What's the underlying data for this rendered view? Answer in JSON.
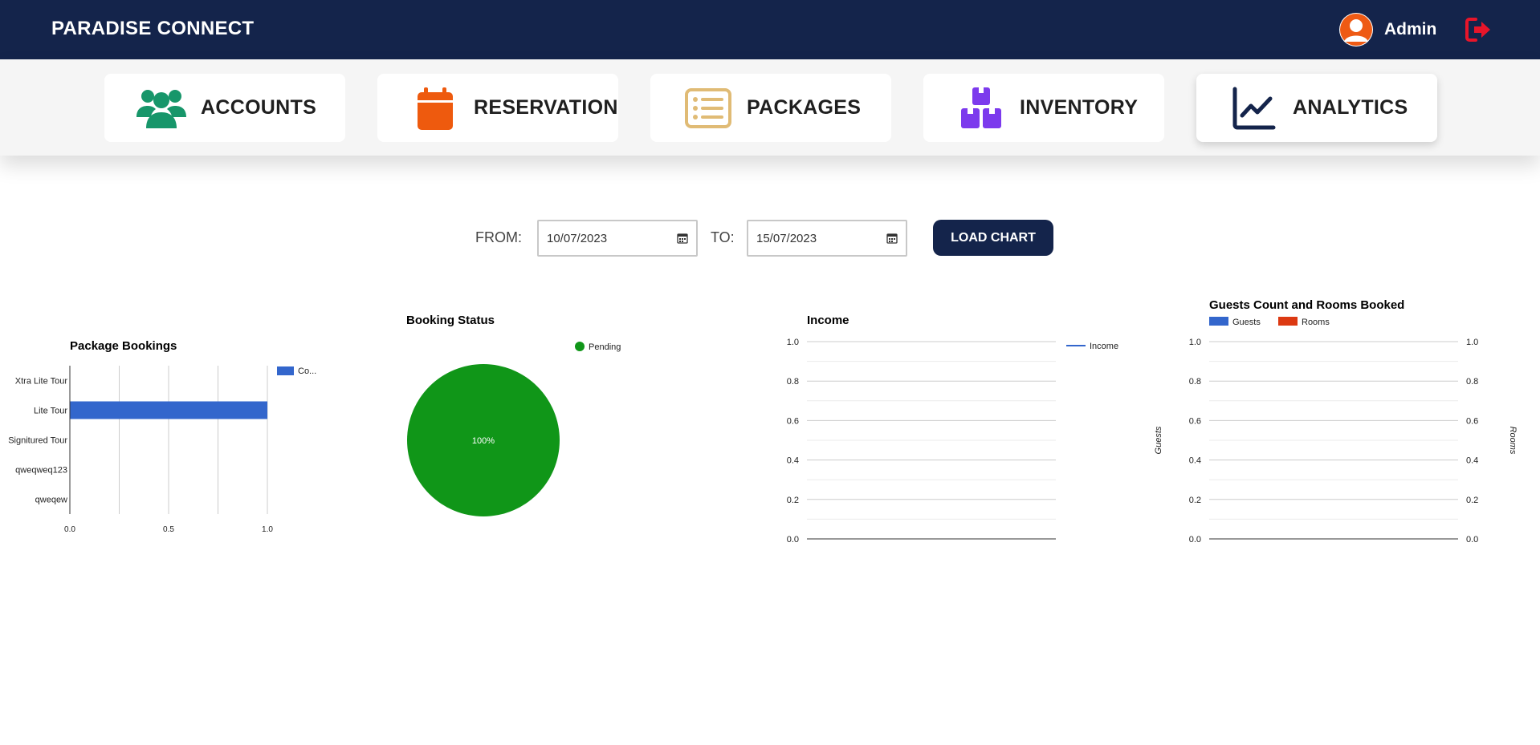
{
  "header": {
    "brand": "PARADISE CONNECT",
    "user_name": "Admin",
    "colors": {
      "bar": "#14244b",
      "avatar": "#ee5a14",
      "logout": "#e8152a"
    }
  },
  "nav": [
    {
      "label": "ACCOUNTS",
      "icon": "users-icon",
      "color": "#17966a"
    },
    {
      "label": "RESERVATION",
      "icon": "calendar-icon",
      "color": "#ee5a0e"
    },
    {
      "label": "PACKAGES",
      "icon": "list-icon",
      "color": "#e0bb75"
    },
    {
      "label": "INVENTORY",
      "icon": "boxes-icon",
      "color": "#7c3aed"
    },
    {
      "label": "ANALYTICS",
      "icon": "chart-line-icon",
      "color": "#14244b",
      "active": true
    }
  ],
  "filters": {
    "from_label": "FROM:",
    "from_value": "10/07/2023",
    "to_label": "TO:",
    "to_value": "15/07/2023",
    "load_label": "LOAD CHART"
  },
  "chart_data": [
    {
      "type": "bar",
      "orientation": "horizontal",
      "title": "Package Bookings",
      "categories": [
        "Xtra Lite Tour",
        "Lite Tour",
        "Signitured Tour",
        "qweqweq123",
        "qweqew"
      ],
      "series": [
        {
          "name": "Co...",
          "values": [
            0,
            1,
            0,
            0,
            0
          ],
          "color": "#3366cc"
        }
      ],
      "xlim": [
        0,
        1
      ],
      "xticks": [
        "0.0",
        "0.5",
        "1.0"
      ],
      "legend": "right"
    },
    {
      "type": "pie",
      "title": "Booking Status",
      "slices": [
        {
          "label": "Pending",
          "value": 1,
          "percent_label": "100%",
          "color": "#109618"
        }
      ],
      "legend": "top-right"
    },
    {
      "type": "line",
      "title": "Income",
      "series": [
        {
          "name": "Income",
          "values": [],
          "color": "#3366cc"
        }
      ],
      "ylim": [
        0,
        1
      ],
      "yticks": [
        "1.0",
        "0.8",
        "0.6",
        "0.4",
        "0.2",
        "0.0"
      ],
      "legend": "right"
    },
    {
      "type": "bar",
      "title": "Guests Count and Rooms Booked",
      "series": [
        {
          "name": "Guests",
          "values": [],
          "color": "#3366cc"
        },
        {
          "name": "Rooms",
          "values": [],
          "color": "#dc3912"
        }
      ],
      "ylabel": "Guests",
      "y2label": "Rooms",
      "ylim": [
        0,
        1
      ],
      "yticks": [
        "1.0",
        "0.8",
        "0.6",
        "0.4",
        "0.2",
        "0.0"
      ],
      "legend": "top"
    }
  ]
}
